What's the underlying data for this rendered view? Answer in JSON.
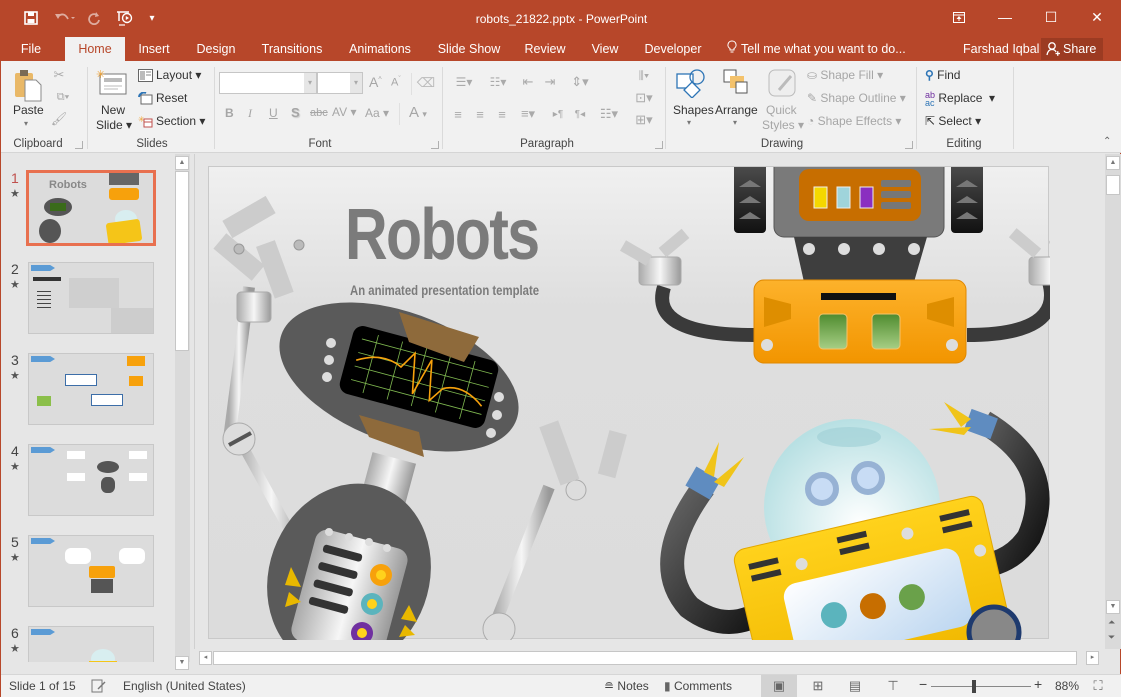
{
  "window": {
    "title": "robots_21822.pptx - PowerPoint",
    "controls": {
      "ribbon_display": "ribbon-display-icon",
      "minimize": "—",
      "maximize": "☐",
      "close": "✕"
    }
  },
  "quick_access": {
    "save": "save-icon",
    "undo": "undo-icon",
    "redo": "redo-icon",
    "start_from_beginning": "slideshow-start-icon",
    "customize": "customize-qat-icon"
  },
  "tabs": [
    {
      "label": "File"
    },
    {
      "label": "Home",
      "active": true
    },
    {
      "label": "Insert"
    },
    {
      "label": "Design"
    },
    {
      "label": "Transitions"
    },
    {
      "label": "Animations"
    },
    {
      "label": "Slide Show"
    },
    {
      "label": "Review"
    },
    {
      "label": "View"
    },
    {
      "label": "Developer"
    }
  ],
  "tell_me": "Tell me what you want to do...",
  "user": "Farshad Iqbal",
  "share": "Share",
  "ribbon": {
    "clipboard": {
      "label": "Clipboard",
      "paste": "Paste"
    },
    "slides": {
      "label": "Slides",
      "new_slide_1": "New",
      "new_slide_2": "Slide",
      "layout": "Layout",
      "reset": "Reset",
      "section": "Section"
    },
    "font": {
      "label": "Font",
      "font_name": "",
      "font_size": "",
      "bold": "B",
      "italic": "I",
      "underline": "U",
      "shadow": "S",
      "strikethrough": "abc",
      "spacing": "AV",
      "change_case": "Aa",
      "font_color": "A",
      "grow": "A",
      "shrink": "A"
    },
    "paragraph": {
      "label": "Paragraph"
    },
    "drawing": {
      "label": "Drawing",
      "shapes": "Shapes",
      "arrange": "Arrange",
      "quick_styles_1": "Quick",
      "quick_styles_2": "Styles",
      "shape_fill": "Shape Fill",
      "shape_outline": "Shape Outline",
      "shape_effects": "Shape Effects"
    },
    "editing": {
      "label": "Editing",
      "find": "Find",
      "replace": "Replace",
      "select": "Select"
    }
  },
  "thumbnails": [
    {
      "number": "1",
      "selected": true,
      "title": "Robots"
    },
    {
      "number": "2",
      "selected": false
    },
    {
      "number": "3",
      "selected": false
    },
    {
      "number": "4",
      "selected": false
    },
    {
      "number": "5",
      "selected": false
    },
    {
      "number": "6",
      "selected": false
    }
  ],
  "slide": {
    "title": "Robots",
    "subtitle": "An animated presentation template",
    "colors": {
      "orange": "#f7a10c",
      "yellow": "#f5c518",
      "dark": "#555555",
      "screen_green": "#6a9e3a"
    }
  },
  "status": {
    "slide_info": "Slide 1 of 15",
    "language": "English (United States)",
    "notes": "Notes",
    "comments": "Comments",
    "zoom_percent": "88%",
    "zoom_value": 88
  }
}
